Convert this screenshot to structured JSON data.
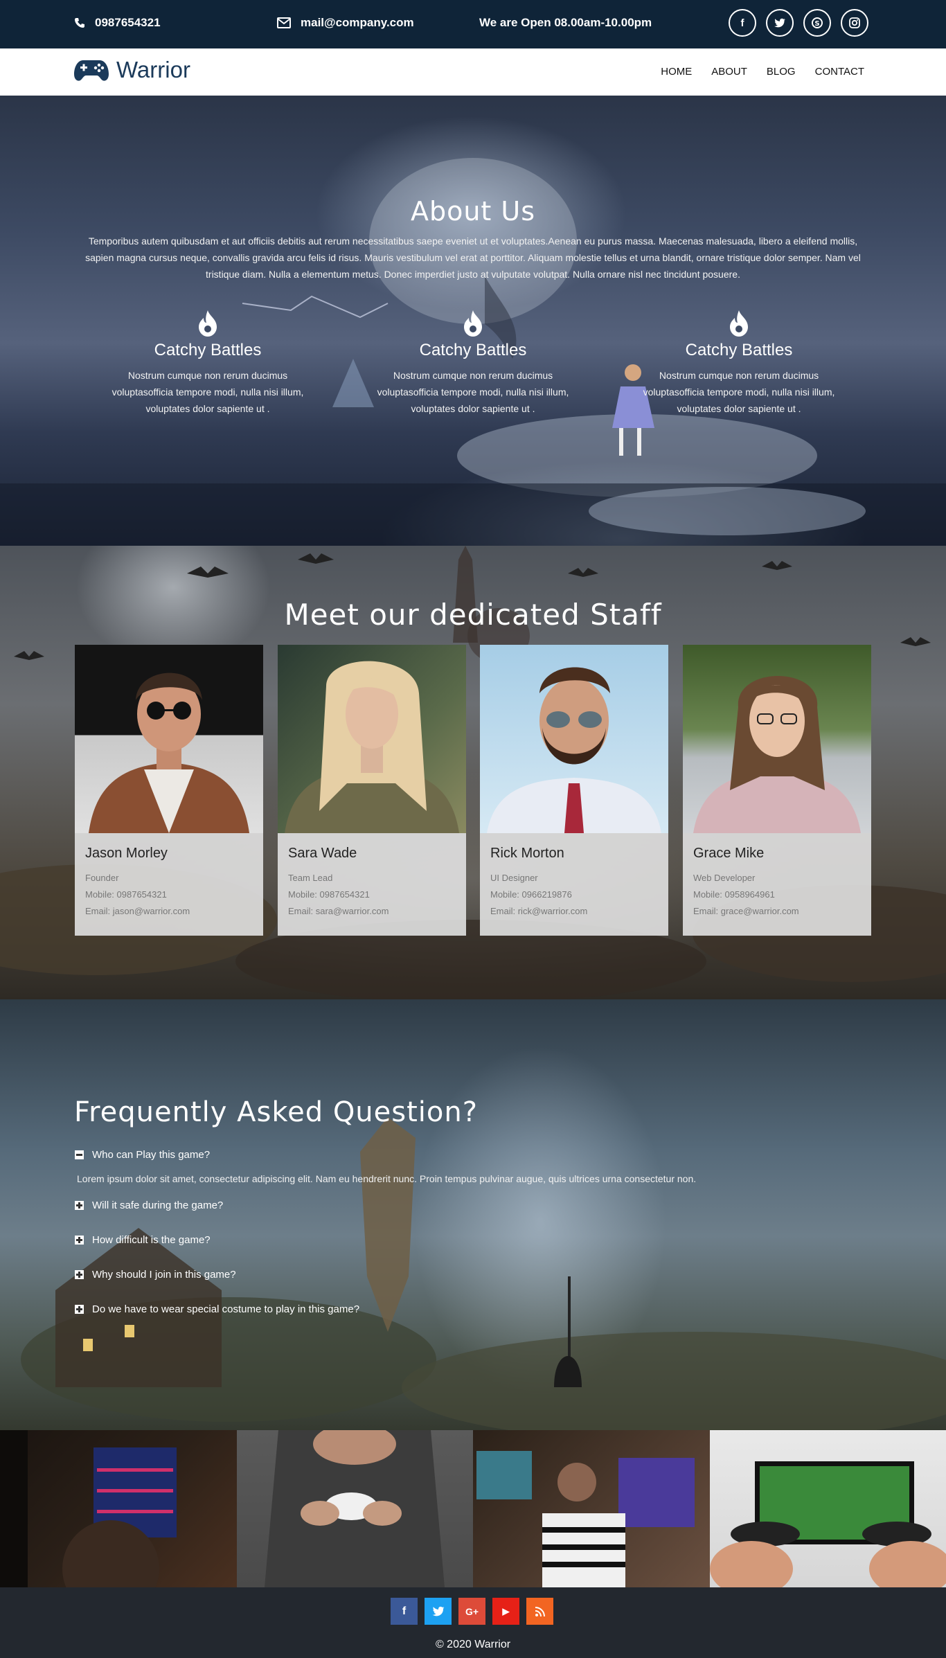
{
  "topbar": {
    "phone": "0987654321",
    "email": "mail@company.com",
    "hours": "We are Open 08.00am-10.00pm",
    "socials": [
      "facebook-icon",
      "twitter-icon",
      "skype-icon",
      "instagram-icon"
    ]
  },
  "nav": {
    "brand": "Warrior",
    "links": [
      "HOME",
      "ABOUT",
      "BLOG",
      "CONTACT"
    ]
  },
  "about": {
    "title": "About Us",
    "description": "Temporibus autem quibusdam et aut officiis debitis aut rerum necessitatibus saepe eveniet ut et voluptates.Aenean eu purus massa. Maecenas malesuada, libero a eleifend mollis, sapien magna cursus neque, convallis gravida arcu felis id risus. Mauris vestibulum vel erat at porttitor. Aliquam molestie tellus et urna blandit, ornare tristique dolor semper. Nam vel tristique diam. Nulla a elementum metus. Donec imperdiet justo at vulputate volutpat. Nulla ornare nisl nec tincidunt posuere.",
    "features": [
      {
        "title": "Catchy Battles",
        "text": "Nostrum cumque non rerum ducimus voluptasofficia tempore modi, nulla nisi illum, voluptates dolor sapiente ut ."
      },
      {
        "title": "Catchy Battles",
        "text": "Nostrum cumque non rerum ducimus voluptasofficia tempore modi, nulla nisi illum, voluptates dolor sapiente ut ."
      },
      {
        "title": "Catchy Battles",
        "text": "Nostrum cumque non rerum ducimus voluptasofficia tempore modi, nulla nisi illum, voluptates dolor sapiente ut ."
      }
    ]
  },
  "staff": {
    "title": "Meet our dedicated Staff",
    "members": [
      {
        "name": "Jason Morley",
        "role": "Founder",
        "mobile": "Mobile: 0987654321",
        "email": "Email: jason@warrior.com"
      },
      {
        "name": "Sara Wade",
        "role": "Team Lead",
        "mobile": "Mobile: 0987654321",
        "email": "Email: sara@warrior.com"
      },
      {
        "name": "Rick Morton",
        "role": "UI Designer",
        "mobile": "Mobile: 0966219876",
        "email": "Email: rick@warrior.com"
      },
      {
        "name": "Grace Mike",
        "role": "Web Developer",
        "mobile": "Mobile: 0958964961",
        "email": "Email: grace@warrior.com"
      }
    ]
  },
  "faq": {
    "title": "Frequently Asked Question?",
    "questions": [
      "Who can Play this game?",
      "Will it safe during the game?",
      "How difficult is the game?",
      "Why should I join in this game?",
      "Do we have to wear special costume to play in this game?"
    ],
    "answer": "Lorem ipsum dolor sit amet, consectetur adipiscing elit. Nam eu hendrerit nunc. Proin tempus pulvinar augue, quis ultrices urna consectetur non."
  },
  "footer": {
    "socials": [
      {
        "icon": "facebook-icon",
        "glyph": "f",
        "color": "#3b5998"
      },
      {
        "icon": "twitter-icon",
        "glyph": "t",
        "color": "#1da1f2"
      },
      {
        "icon": "google-plus-icon",
        "glyph": "G+",
        "color": "#dd4b39"
      },
      {
        "icon": "youtube-icon",
        "glyph": "▶",
        "color": "#e62117"
      },
      {
        "icon": "rss-icon",
        "glyph": "◉",
        "color": "#f26522"
      }
    ],
    "copyright": "© 2020 Warrior"
  }
}
